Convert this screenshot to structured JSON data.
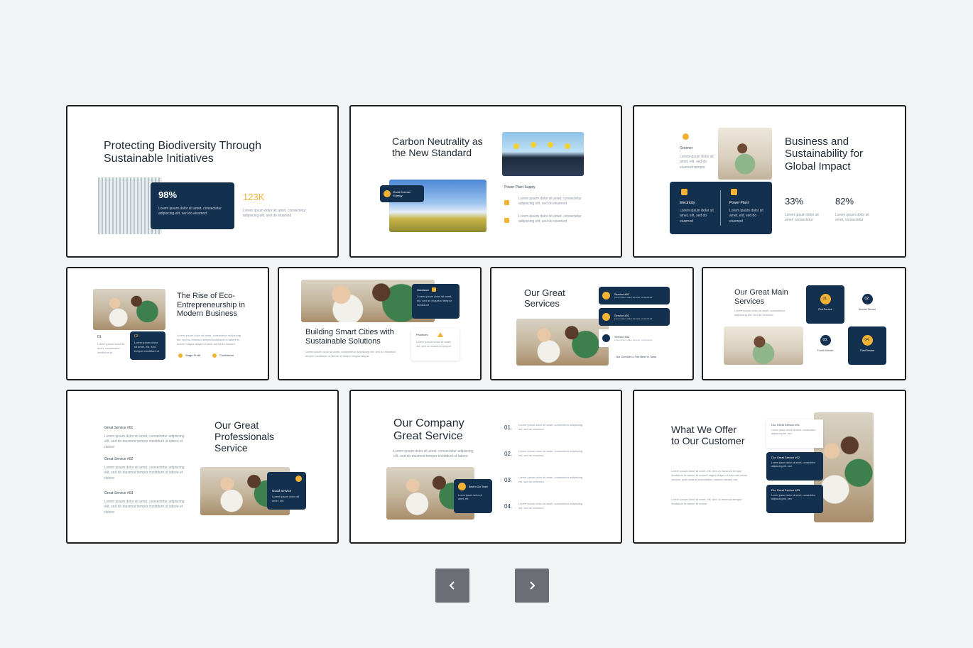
{
  "slides": {
    "s1": {
      "title": "Protecting Biodiversity Through\nSustainable Initiatives",
      "stat1": "98%",
      "stat2": "123K",
      "stat1_text": "Lorem ipsum dolor sit amet, consectetur adipiscing elit, sed do eiusmod",
      "stat2_text": "Lorem ipsum dolor sit amet, consectetur adipiscing elit, sed do eiusmod"
    },
    "s2": {
      "title": "Carbon Neutrality as\nthe New Standard",
      "badge": "Build Greener Energy",
      "subtitle": "Power Plant Supply",
      "row1": "Lorem ipsum dolor sit amet, consectetur adipiscing elit, sed do eiusmod",
      "row2": "Lorem ipsum dolor sit amet, consectetur adipiscing elit, sed do eiusmod"
    },
    "s3": {
      "title": "Business and\nSustainability for\nGlobal Impact",
      "greener": "Greener",
      "greener_text": "Lorem ipsum dolor sit amet, elit, sed do eiusmod tempor",
      "box1_label": "Electricity",
      "box2_label": "Power Plant",
      "box_text": "Lorem ipsum dolor sit amet, elit, sed do eiusmod",
      "stat1": "33%",
      "stat2": "82%",
      "stat_text": "Lorem ipsum dolor sit amet, consectetur"
    },
    "s4": {
      "title": "The Rise of Eco-\nEntrepreneurship in\nModern Business",
      "num1": "01",
      "num2": "02",
      "num1_text": "Lorem ipsum dolor sit amet, consectetur incididunt ut",
      "num2_text": "Lorem ipsum dolor sit amet, elit, sed tempor incididunt ut",
      "body": "Lorem ipsum dolor sit amet, consectetur adipiscing elit, sed do eiusmod tempor incididunt ut labore et dolore magna aliqua ut enim ad minim veniam",
      "tag1": "Stage Profit",
      "tag2": "Confidence"
    },
    "s5": {
      "title": "Building Smart Cities with\nSustainable Solutions",
      "box_label": "Guidance",
      "box_text": "Lorem ipsum dolor sit amet, elit, sed do eiusmod tempor incididunt",
      "side_label": "Practices",
      "side_text": "Lorem ipsum dolor sit amet, elit, sed do eiusmod tempor",
      "body": "Lorem ipsum dolor sit amet, consectetur adipiscing elit, sed do eiusmod tempor incididunt ut labore et dolore magna aliqua"
    },
    "s6": {
      "title": "Our Great\nServices",
      "services": [
        "Service #01",
        "Service #02",
        "Service #03"
      ],
      "service_text": "Lorem ipsum dolor sit amet, consectetur",
      "footer": "Our Service Is The Best In Town"
    },
    "s7": {
      "title": "Our Great Main\nServices",
      "intro": "Lorem ipsum dolor sit amet, consectetur adipiscing elit, sed do eiusmod",
      "items": [
        {
          "num": "01.",
          "label": "First Service"
        },
        {
          "num": "02.",
          "label": "Second Service"
        },
        {
          "num": "03.",
          "label": "Fourth Service"
        },
        {
          "num": "04.",
          "label": "Third Service"
        }
      ],
      "item_text": "Lorem ipsum dolor sit amet, consectetur"
    },
    "s8": {
      "title": "Our Great\nProfessionals\nService",
      "items": [
        "Great Service #01",
        "Great Service #02",
        "Great Service #03"
      ],
      "item_text": "Lorem ipsum dolor sit amet, consectetur adipiscing elit, sed do eiusmod tempor incididunt ut labore et dolore",
      "box_label": "Good Service",
      "box_text": "Lorem ipsum dolor sit amet, elit."
    },
    "s9": {
      "title": "Our Company\nGreat Service",
      "body": "Lorem ipsum dolor sit amet, consectetur adipiscing elit, sed do eiusmod tempor incididunt ut labore",
      "box_label": "Best in Our Town",
      "box_text": "Lorem ipsum dolor sit amet, elit.",
      "nums": [
        "01.",
        "02.",
        "03.",
        "04."
      ],
      "num_text": "Lorem ipsum dolor sit amet, consectetur adipiscing elit, sed do eiusmod"
    },
    "s10": {
      "title": "What We Offer\nto Our Customer",
      "body": "Lorem ipsum dolor sit amet, elit, sed do eiusmod tempor incididunt ut labore et dolore magna aliqua ut enim ad minim veniam, quis nostrud exercitation ullamco laboris nisi",
      "body2": "Lorem ipsum dolor sit amet, elit, sed do eiusmod tempor incididunt ut labore et dolore",
      "items": [
        "Our Great Service #01",
        "Our Great Service #02",
        "Our Great Service #03"
      ],
      "item_text": "Lorem ipsum dolor sit amet, consectetur adipiscing elit, sed"
    }
  },
  "nav": {
    "prev_icon": "chevron-left-icon",
    "next_icon": "chevron-right-icon"
  },
  "colors": {
    "navy": "#13304f",
    "gold": "#f2b233",
    "background": "#f2f3f5"
  }
}
